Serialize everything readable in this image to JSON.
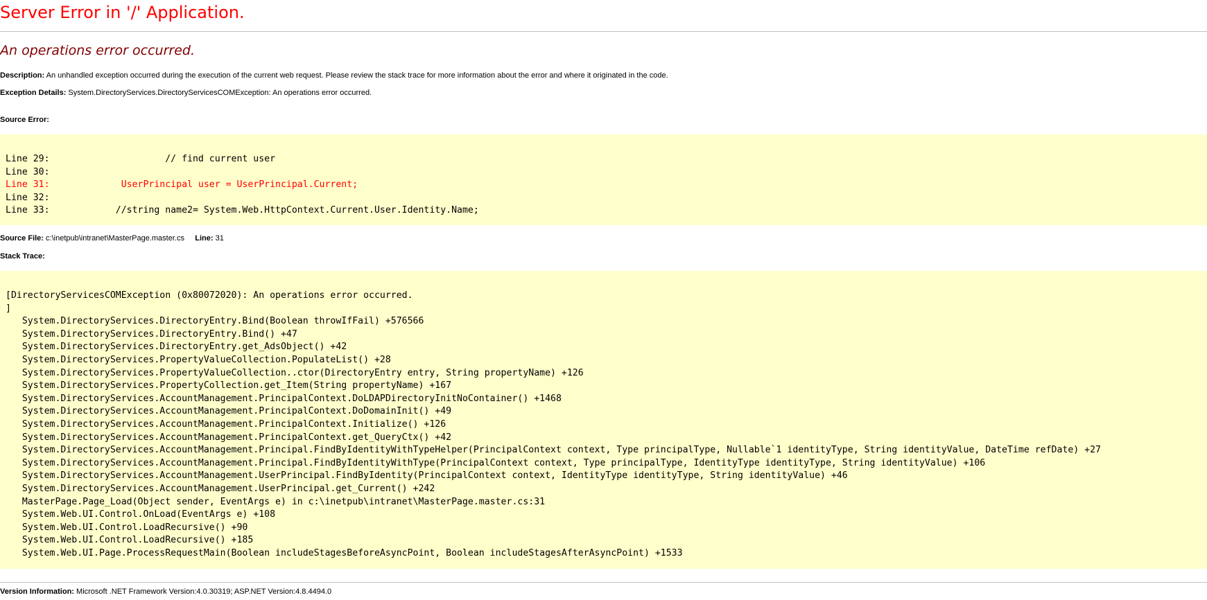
{
  "page": {
    "title": "Server Error in '/' Application.",
    "error_message": "An operations error occurred."
  },
  "description": {
    "label": "Description:",
    "text": " An unhandled exception occurred during the execution of the current web request. Please review the stack trace for more information about the error and where it originated in the code."
  },
  "exception_details": {
    "label": "Exception Details:",
    "text": " System.DirectoryServices.DirectoryServicesCOMException: An operations error occurred."
  },
  "source_error": {
    "label": "Source Error:",
    "lines": [
      {
        "text": "Line 29:                     // find current user",
        "highlight": false
      },
      {
        "text": "Line 30:",
        "highlight": false
      },
      {
        "text": "Line 31:             UserPrincipal user = UserPrincipal.Current;",
        "highlight": true
      },
      {
        "text": "Line 32:",
        "highlight": false
      },
      {
        "text": "Line 33:            //string name2= System.Web.HttpContext.Current.User.Identity.Name;",
        "highlight": false
      }
    ]
  },
  "source_file": {
    "label": "Source File:",
    "path": " c:\\inetpub\\intranet\\MasterPage.master.cs",
    "line_label": "Line:",
    "line_number": " 31"
  },
  "stack_trace": {
    "label": "Stack Trace:",
    "lines": [
      "[DirectoryServicesCOMException (0x80072020): An operations error occurred.",
      "]",
      "   System.DirectoryServices.DirectoryEntry.Bind(Boolean throwIfFail) +576566",
      "   System.DirectoryServices.DirectoryEntry.Bind() +47",
      "   System.DirectoryServices.DirectoryEntry.get_AdsObject() +42",
      "   System.DirectoryServices.PropertyValueCollection.PopulateList() +28",
      "   System.DirectoryServices.PropertyValueCollection..ctor(DirectoryEntry entry, String propertyName) +126",
      "   System.DirectoryServices.PropertyCollection.get_Item(String propertyName) +167",
      "   System.DirectoryServices.AccountManagement.PrincipalContext.DoLDAPDirectoryInitNoContainer() +1468",
      "   System.DirectoryServices.AccountManagement.PrincipalContext.DoDomainInit() +49",
      "   System.DirectoryServices.AccountManagement.PrincipalContext.Initialize() +126",
      "   System.DirectoryServices.AccountManagement.PrincipalContext.get_QueryCtx() +42",
      "   System.DirectoryServices.AccountManagement.Principal.FindByIdentityWithTypeHelper(PrincipalContext context, Type principalType, Nullable`1 identityType, String identityValue, DateTime refDate) +27",
      "   System.DirectoryServices.AccountManagement.Principal.FindByIdentityWithType(PrincipalContext context, Type principalType, IdentityType identityType, String identityValue) +106",
      "   System.DirectoryServices.AccountManagement.UserPrincipal.FindByIdentity(PrincipalContext context, IdentityType identityType, String identityValue) +46",
      "   System.DirectoryServices.AccountManagement.UserPrincipal.get_Current() +242",
      "   MasterPage.Page_Load(Object sender, EventArgs e) in c:\\inetpub\\intranet\\MasterPage.master.cs:31",
      "   System.Web.UI.Control.OnLoad(EventArgs e) +108",
      "   System.Web.UI.Control.LoadRecursive() +90",
      "   System.Web.UI.Control.LoadRecursive() +185",
      "   System.Web.UI.Page.ProcessRequestMain(Boolean includeStagesBeforeAsyncPoint, Boolean includeStagesAfterAsyncPoint) +1533"
    ]
  },
  "version_info": {
    "label": "Version Information:",
    "text": " Microsoft .NET Framework Version:4.0.30319; ASP.NET Version:4.8.4494.0"
  },
  "colors": {
    "title": "#ff0000",
    "error_message": "#800000",
    "code_background": "#ffffcc",
    "highlight_line": "#ff0000"
  }
}
